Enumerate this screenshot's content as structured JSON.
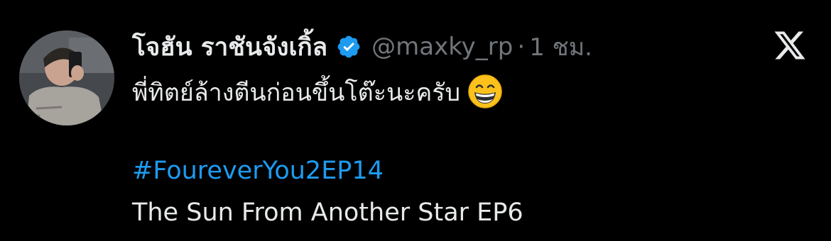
{
  "tweet": {
    "author": {
      "display_name": "โจฮัน ราชันจังเกิ้ล",
      "handle": "@maxky_rp",
      "verified": true,
      "avatar_icon": "user-photo-avatar"
    },
    "separator": "·",
    "time": "1 ชม.",
    "text": "พี่ทิตย์ล้างตีนก่อนขึ้นโต๊ะนะครับ",
    "emoji": "grinning-face-with-smiling-eyes-emoji",
    "hashtag": "#FoureverYou2EP14",
    "extra_line": "The Sun From Another Star EP6"
  },
  "colors": {
    "background": "#000000",
    "primary_text": "#e7e9ea",
    "secondary_text": "#71767b",
    "link": "#1d9bf0",
    "verified_badge": "#1d9bf0"
  },
  "icons": {
    "platform_logo": "x-logo-icon",
    "verified": "verified-badge-icon"
  }
}
